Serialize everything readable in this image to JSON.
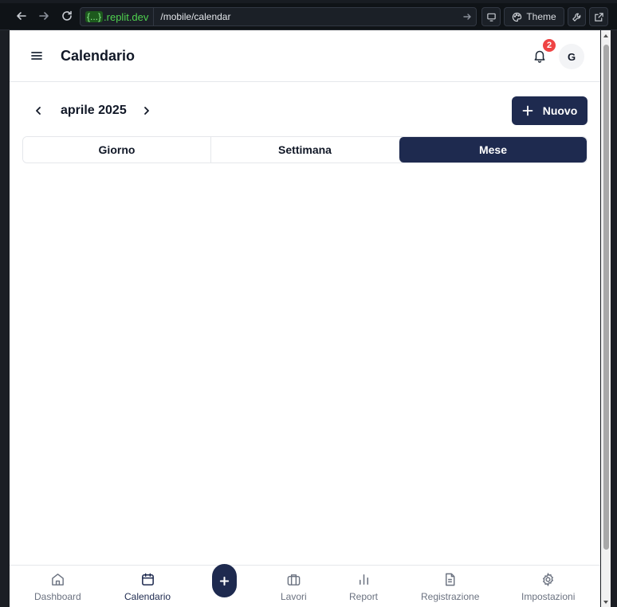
{
  "browser": {
    "domain_brace": "{...}",
    "domain": ".replit.dev",
    "path": "/mobile/calendar",
    "theme_label": "Theme"
  },
  "header": {
    "title": "Calendario",
    "notification_count": "2",
    "avatar_initial": "G"
  },
  "calendar": {
    "month_label": "aprile 2025",
    "new_button_label": "Nuovo",
    "tabs": [
      {
        "label": "Giorno",
        "active": false
      },
      {
        "label": "Settimana",
        "active": false
      },
      {
        "label": "Mese",
        "active": true
      }
    ]
  },
  "bottom_nav": {
    "items": [
      {
        "label": "Dashboard",
        "icon": "home-icon",
        "active": false
      },
      {
        "label": "Calendario",
        "icon": "calendar-icon",
        "active": true
      },
      {
        "label": "Lavori",
        "icon": "briefcase-icon",
        "active": false
      },
      {
        "label": "Report",
        "icon": "bar-chart-icon",
        "active": false
      },
      {
        "label": "Registrazione",
        "icon": "document-icon",
        "active": false
      },
      {
        "label": "Impostazioni",
        "icon": "gear-icon",
        "active": false
      }
    ]
  },
  "colors": {
    "primary": "#1e2a4f",
    "badge": "#ef4444",
    "domain_green": "#4fd14f"
  }
}
